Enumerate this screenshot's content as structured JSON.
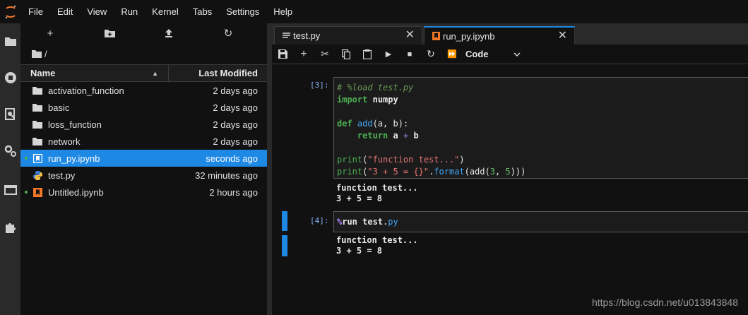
{
  "menubar": {
    "items": [
      "File",
      "Edit",
      "View",
      "Run",
      "Kernel",
      "Tabs",
      "Settings",
      "Help"
    ]
  },
  "filebrowser": {
    "path": "/",
    "header": {
      "name": "Name",
      "modified": "Last Modified"
    },
    "items": [
      {
        "name": "activation_function",
        "type": "folder",
        "modified": "2 days ago"
      },
      {
        "name": "basic",
        "type": "folder",
        "modified": "2 days ago"
      },
      {
        "name": "loss_function",
        "type": "folder",
        "modified": "2 days ago"
      },
      {
        "name": "network",
        "type": "folder",
        "modified": "2 days ago"
      },
      {
        "name": "run_py.ipynb",
        "type": "notebook",
        "modified": "seconds ago",
        "selected": true,
        "running": true
      },
      {
        "name": "test.py",
        "type": "python",
        "modified": "32 minutes ago"
      },
      {
        "name": "Untitled.ipynb",
        "type": "notebook",
        "modified": "2 hours ago",
        "running": true
      }
    ]
  },
  "tabs": [
    {
      "label": "test.py",
      "icon": "text-file-icon",
      "close": "✕"
    },
    {
      "label": "run_py.ipynb",
      "icon": "notebook-icon",
      "close": "✕",
      "active": true
    }
  ],
  "toolbar": {
    "cell_type": "Code"
  },
  "cells": [
    {
      "prompt": "[3]:",
      "output": [
        "function test...",
        "3 + 5 = 8"
      ]
    },
    {
      "prompt": "[4]:",
      "output": [
        "function test...",
        "3 + 5 = 8"
      ]
    }
  ],
  "watermark": "https://blog.csdn.net/u013843848",
  "colors": {
    "accent": "#1e88e5",
    "background": "#111111",
    "running_dot": "#4caf50"
  }
}
